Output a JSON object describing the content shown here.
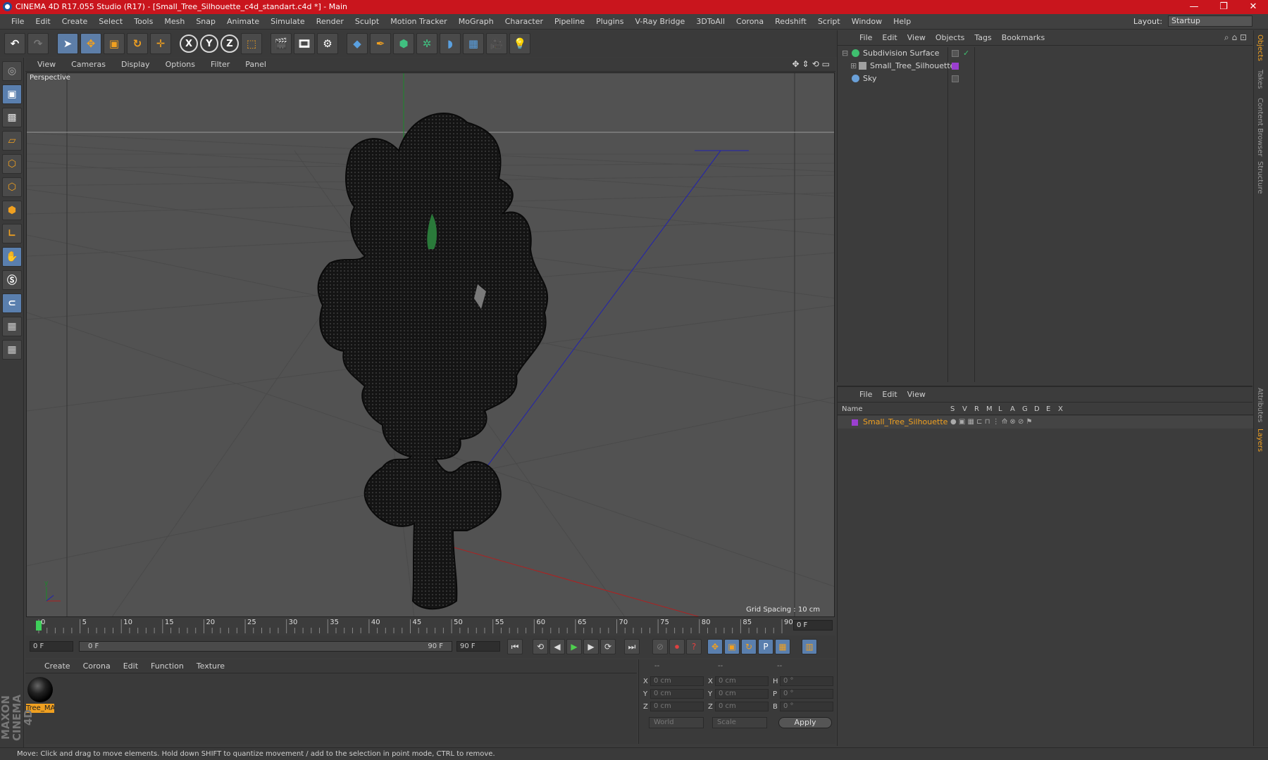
{
  "titlebar": {
    "title": "CINEMA 4D R17.055 Studio (R17) - [Small_Tree_Silhouette_c4d_standart.c4d *] - Main",
    "minimize": "—",
    "maximize": "❐",
    "close": "✕"
  },
  "menubar": {
    "items": [
      "File",
      "Edit",
      "Create",
      "Select",
      "Tools",
      "Mesh",
      "Snap",
      "Animate",
      "Simulate",
      "Render",
      "Sculpt",
      "Motion Tracker",
      "MoGraph",
      "Character",
      "Pipeline",
      "Plugins",
      "V-Ray Bridge",
      "3DToAll",
      "Corona",
      "Redshift",
      "Script",
      "Window",
      "Help"
    ],
    "layout_label": "Layout:",
    "layout_value": "Startup"
  },
  "toolbar": {
    "x": "X",
    "y": "Y",
    "z": "Z"
  },
  "viewport": {
    "menu": [
      "View",
      "Cameras",
      "Display",
      "Options",
      "Filter",
      "Panel"
    ],
    "label": "Perspective",
    "grid_spacing": "Grid Spacing : 10 cm"
  },
  "timeline": {
    "ticks": [
      "0",
      "5",
      "10",
      "15",
      "20",
      "25",
      "30",
      "35",
      "40",
      "45",
      "50",
      "55",
      "60",
      "65",
      "70",
      "75",
      "80",
      "85",
      "90"
    ],
    "current_frame": "0 F"
  },
  "transport": {
    "start": "0 F",
    "range_start": "0 F",
    "range_end": "90 F",
    "end": "90 F"
  },
  "materials": {
    "menu": [
      "Create",
      "Corona",
      "Edit",
      "Function",
      "Texture"
    ],
    "items": [
      {
        "name": "Tree_MA"
      }
    ]
  },
  "coords": {
    "headers": [
      "--",
      "--",
      "--"
    ],
    "rows": [
      {
        "a": "X",
        "av": "0 cm",
        "b": "X",
        "bv": "0 cm",
        "c": "H",
        "cv": "0 °"
      },
      {
        "a": "Y",
        "av": "0 cm",
        "b": "Y",
        "bv": "0 cm",
        "c": "P",
        "cv": "0 °"
      },
      {
        "a": "Z",
        "av": "0 cm",
        "b": "Z",
        "bv": "0 cm",
        "c": "B",
        "cv": "0 °"
      }
    ],
    "world": "World",
    "scale": "Scale",
    "apply": "Apply"
  },
  "objects": {
    "menu": [
      "File",
      "Edit",
      "View",
      "Objects",
      "Tags",
      "Bookmarks"
    ],
    "items": [
      {
        "name": "Subdivision Surface",
        "color": "#3fbf6f"
      },
      {
        "name": "Small_Tree_Silhouette",
        "color": "#a0a0a0"
      },
      {
        "name": "Sky",
        "color": "#6aa0d8"
      }
    ]
  },
  "layers": {
    "menu": [
      "File",
      "Edit",
      "View"
    ],
    "columns": [
      "Name",
      "S",
      "V",
      "R",
      "M",
      "L",
      "A",
      "G",
      "D",
      "E",
      "X"
    ],
    "row_name": "Small_Tree_Silhouette",
    "row_color": "#9b3fd0"
  },
  "righttabs": [
    "Objects",
    "Takes",
    "Content Browser",
    "Structure",
    "Attributes",
    "Layers"
  ],
  "status": "Move: Click and drag to move elements. Hold down SHIFT to quantize movement / add to the selection in point mode, CTRL to remove.",
  "logo": "MAXON CINEMA 4D",
  "colors": {
    "accent": "#f0a020",
    "title_red": "#c9151d",
    "layer_purple": "#9b3fd0"
  }
}
